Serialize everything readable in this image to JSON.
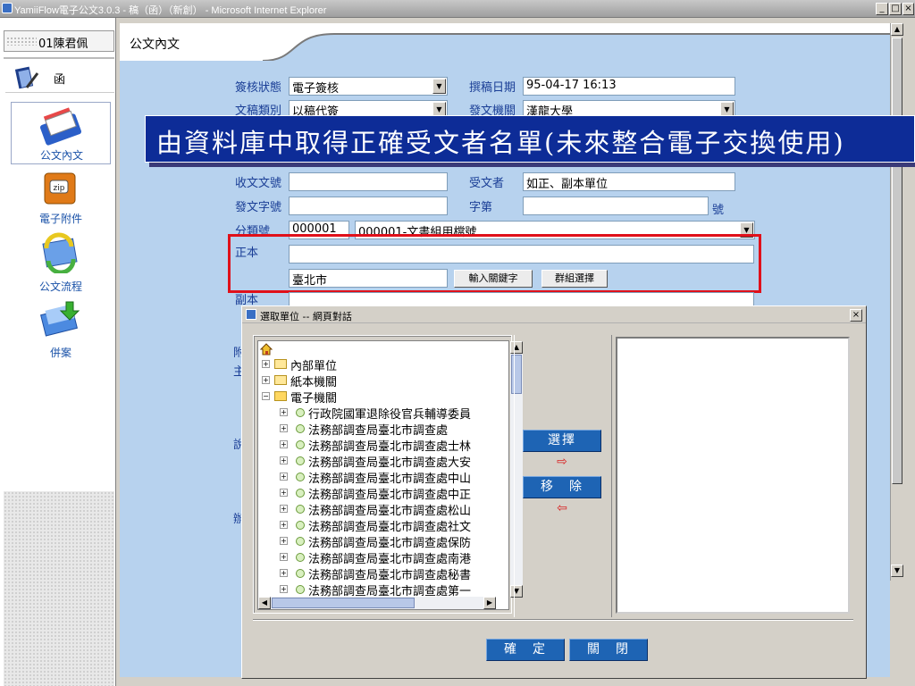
{
  "window": {
    "title": "YamiiFlow電子公文3.0.3 - 稿（函）（新創） - Microsoft Internet Explorer",
    "minimize": "_",
    "maximize": "□",
    "close": "×"
  },
  "sidebar": {
    "user": "01陳君佩",
    "doc_type": "函",
    "items": [
      {
        "label": "公文內文",
        "icon": "folder-docs-icon"
      },
      {
        "label": "電子附件",
        "icon": "zip-icon"
      },
      {
        "label": "公文流程",
        "icon": "refresh-arrows-icon"
      },
      {
        "label": "併案",
        "icon": "merge-docs-icon"
      }
    ]
  },
  "main": {
    "tab_title": "公文內文"
  },
  "form": {
    "status_label": "簽核狀態",
    "status_value": "電子簽核",
    "draft_date_label": "撰稿日期",
    "draft_date_value": "95-04-17  16:13",
    "doc_category_label": "文稿類別",
    "doc_category_value": "以稿代簽",
    "issuing_agency_label": "發文機關",
    "issuing_agency_value": "漢龍大學",
    "received_no_label": "收文文號",
    "received_no_value": "",
    "recipient_label": "受文者",
    "recipient_value": "如正、副本單位",
    "issue_no_label": "發文字號",
    "issue_no_value": "",
    "word_no_label": "字第",
    "word_no_value": "",
    "number_suffix": "號",
    "class_no_label": "分類號",
    "class_no_value": "000001",
    "class_select_value": "000001-文書組用檔號",
    "main_recipient_label": "正本",
    "main_recipient_value": "",
    "keyword_value": "臺北市",
    "keyword_button": "輸入關鍵字",
    "group_button": "群組選擇",
    "cc_label": "副本",
    "partial_labels": [
      "附",
      "主",
      "說",
      "辦"
    ]
  },
  "banner": {
    "text": "由資料庫中取得正確受文者名單(未來整合電子交換使用)"
  },
  "dialog": {
    "title": "選取單位 -- 網頁對話",
    "close": "×",
    "tree": {
      "root_icon": "home-icon",
      "folders": [
        "內部單位",
        "紙本機關",
        "電子機關"
      ],
      "agencies": [
        "行政院國軍退除役官兵輔導委員",
        "法務部調查局臺北市調查處",
        "法務部調查局臺北市調查處士林",
        "法務部調查局臺北市調查處大安",
        "法務部調查局臺北市調查處中山",
        "法務部調查局臺北市調查處中正",
        "法務部調查局臺北市調查處松山",
        "法務部調查局臺北市調查處社文",
        "法務部調查局臺北市調查處保防",
        "法務部調查局臺北市調查處南港",
        "法務部調查局臺北市調查處秘書",
        "法務部調查局臺北市調查處第一"
      ]
    },
    "select_button": "選擇",
    "remove_button": "移　除",
    "ok_button": "確　定",
    "close_button": "關　閉"
  }
}
